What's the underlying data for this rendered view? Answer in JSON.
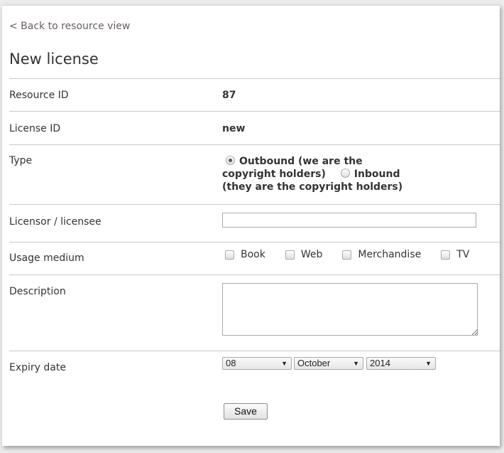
{
  "nav": {
    "back_link": "< Back to resource view"
  },
  "page": {
    "title": "New license"
  },
  "form": {
    "resource_id": {
      "label": "Resource ID",
      "value": "87"
    },
    "license_id": {
      "label": "License ID",
      "value": "new"
    },
    "type": {
      "label": "Type",
      "options": [
        {
          "label": "Outbound (we are the copyright holders)",
          "checked": true
        },
        {
          "label": "Inbound (they are the copyright holders)",
          "checked": false
        }
      ]
    },
    "licensor": {
      "label": "Licensor / licensee",
      "value": "",
      "placeholder": ""
    },
    "usage_medium": {
      "label": "Usage medium",
      "options": [
        {
          "label": "Book",
          "checked": false
        },
        {
          "label": "Web",
          "checked": false
        },
        {
          "label": "Merchandise",
          "checked": false
        },
        {
          "label": "TV",
          "checked": false
        }
      ]
    },
    "description": {
      "label": "Description",
      "value": ""
    },
    "expiry_date": {
      "label": "Expiry date",
      "day": "08",
      "month": "October",
      "year": "2014"
    },
    "save_label": "Save"
  }
}
